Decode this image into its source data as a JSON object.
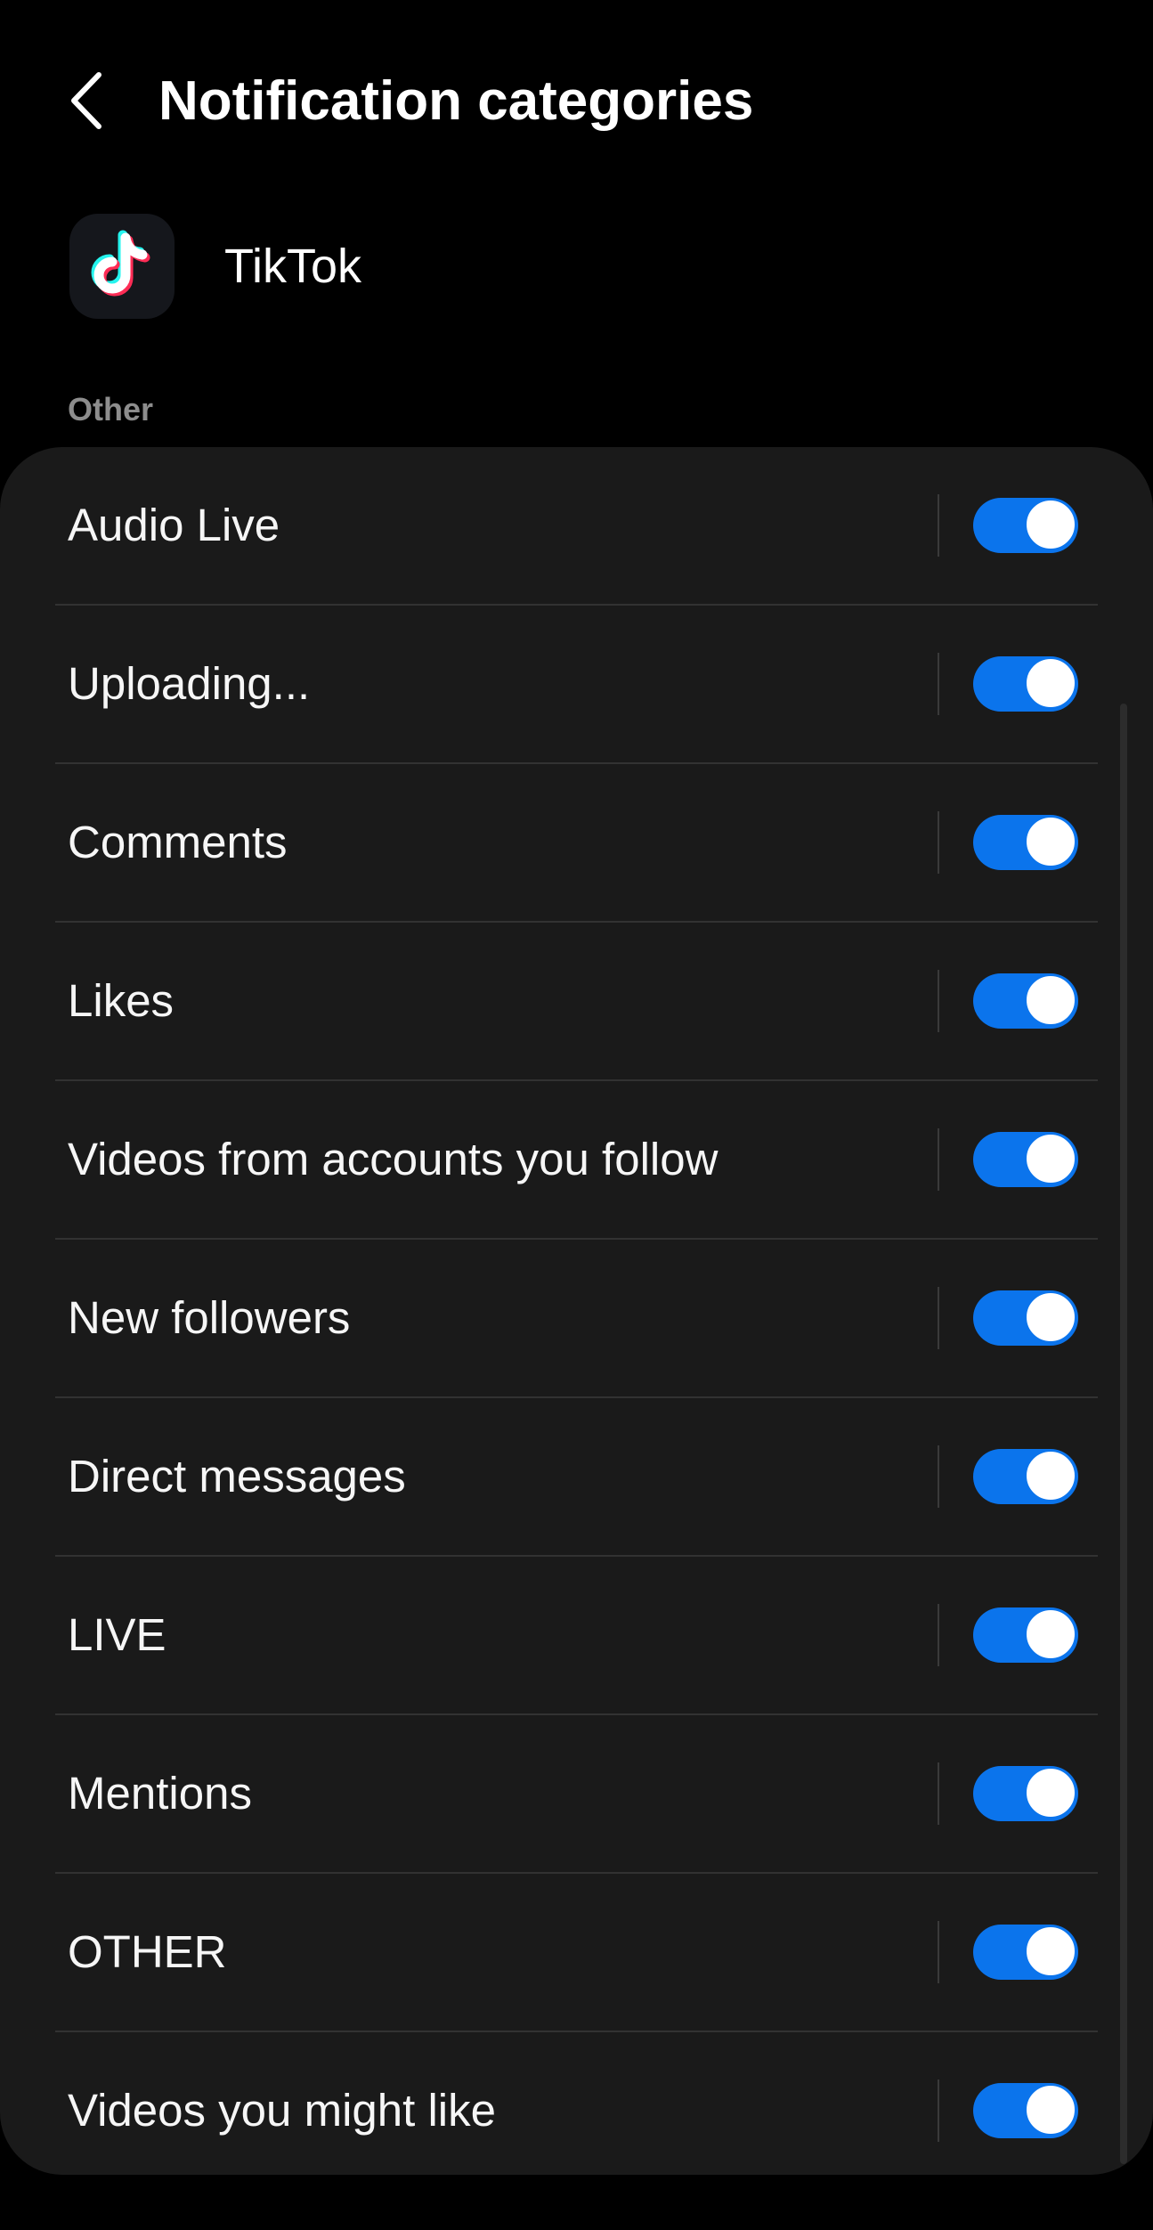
{
  "header": {
    "back_icon": "chevron-left-icon",
    "title": "Notification categories"
  },
  "app": {
    "icon": "tiktok-logo-icon",
    "name": "TikTok"
  },
  "section_label": "Other",
  "colors": {
    "background": "#000000",
    "card": "#1a1a1a",
    "accent": "#0b74ec",
    "toggle_on_track": "#0b74ec",
    "section_label": "#8d8d8d"
  },
  "categories": [
    {
      "label": "Audio Live",
      "enabled": true
    },
    {
      "label": "Uploading...",
      "enabled": true
    },
    {
      "label": "Comments",
      "enabled": true
    },
    {
      "label": "Likes",
      "enabled": true
    },
    {
      "label": "Videos from accounts you follow",
      "enabled": true
    },
    {
      "label": "New followers",
      "enabled": true
    },
    {
      "label": "Direct messages",
      "enabled": true
    },
    {
      "label": "LIVE",
      "enabled": true
    },
    {
      "label": "Mentions",
      "enabled": true
    },
    {
      "label": "OTHER",
      "enabled": true
    },
    {
      "label": "Videos you might like",
      "enabled": true
    }
  ]
}
